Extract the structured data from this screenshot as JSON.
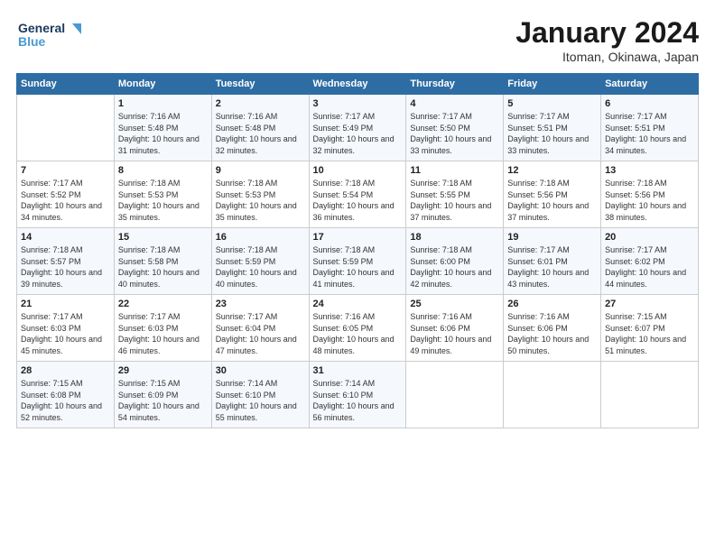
{
  "header": {
    "logo_line1": "General",
    "logo_line2": "Blue",
    "month": "January 2024",
    "location": "Itoman, Okinawa, Japan"
  },
  "weekdays": [
    "Sunday",
    "Monday",
    "Tuesday",
    "Wednesday",
    "Thursday",
    "Friday",
    "Saturday"
  ],
  "weeks": [
    [
      {
        "day": "",
        "sunrise": "",
        "sunset": "",
        "daylight": ""
      },
      {
        "day": "1",
        "sunrise": "7:16 AM",
        "sunset": "5:48 PM",
        "daylight": "10 hours and 31 minutes."
      },
      {
        "day": "2",
        "sunrise": "7:16 AM",
        "sunset": "5:48 PM",
        "daylight": "10 hours and 32 minutes."
      },
      {
        "day": "3",
        "sunrise": "7:17 AM",
        "sunset": "5:49 PM",
        "daylight": "10 hours and 32 minutes."
      },
      {
        "day": "4",
        "sunrise": "7:17 AM",
        "sunset": "5:50 PM",
        "daylight": "10 hours and 33 minutes."
      },
      {
        "day": "5",
        "sunrise": "7:17 AM",
        "sunset": "5:51 PM",
        "daylight": "10 hours and 33 minutes."
      },
      {
        "day": "6",
        "sunrise": "7:17 AM",
        "sunset": "5:51 PM",
        "daylight": "10 hours and 34 minutes."
      }
    ],
    [
      {
        "day": "7",
        "sunrise": "7:17 AM",
        "sunset": "5:52 PM",
        "daylight": "10 hours and 34 minutes."
      },
      {
        "day": "8",
        "sunrise": "7:18 AM",
        "sunset": "5:53 PM",
        "daylight": "10 hours and 35 minutes."
      },
      {
        "day": "9",
        "sunrise": "7:18 AM",
        "sunset": "5:53 PM",
        "daylight": "10 hours and 35 minutes."
      },
      {
        "day": "10",
        "sunrise": "7:18 AM",
        "sunset": "5:54 PM",
        "daylight": "10 hours and 36 minutes."
      },
      {
        "day": "11",
        "sunrise": "7:18 AM",
        "sunset": "5:55 PM",
        "daylight": "10 hours and 37 minutes."
      },
      {
        "day": "12",
        "sunrise": "7:18 AM",
        "sunset": "5:56 PM",
        "daylight": "10 hours and 37 minutes."
      },
      {
        "day": "13",
        "sunrise": "7:18 AM",
        "sunset": "5:56 PM",
        "daylight": "10 hours and 38 minutes."
      }
    ],
    [
      {
        "day": "14",
        "sunrise": "7:18 AM",
        "sunset": "5:57 PM",
        "daylight": "10 hours and 39 minutes."
      },
      {
        "day": "15",
        "sunrise": "7:18 AM",
        "sunset": "5:58 PM",
        "daylight": "10 hours and 40 minutes."
      },
      {
        "day": "16",
        "sunrise": "7:18 AM",
        "sunset": "5:59 PM",
        "daylight": "10 hours and 40 minutes."
      },
      {
        "day": "17",
        "sunrise": "7:18 AM",
        "sunset": "5:59 PM",
        "daylight": "10 hours and 41 minutes."
      },
      {
        "day": "18",
        "sunrise": "7:18 AM",
        "sunset": "6:00 PM",
        "daylight": "10 hours and 42 minutes."
      },
      {
        "day": "19",
        "sunrise": "7:17 AM",
        "sunset": "6:01 PM",
        "daylight": "10 hours and 43 minutes."
      },
      {
        "day": "20",
        "sunrise": "7:17 AM",
        "sunset": "6:02 PM",
        "daylight": "10 hours and 44 minutes."
      }
    ],
    [
      {
        "day": "21",
        "sunrise": "7:17 AM",
        "sunset": "6:03 PM",
        "daylight": "10 hours and 45 minutes."
      },
      {
        "day": "22",
        "sunrise": "7:17 AM",
        "sunset": "6:03 PM",
        "daylight": "10 hours and 46 minutes."
      },
      {
        "day": "23",
        "sunrise": "7:17 AM",
        "sunset": "6:04 PM",
        "daylight": "10 hours and 47 minutes."
      },
      {
        "day": "24",
        "sunrise": "7:16 AM",
        "sunset": "6:05 PM",
        "daylight": "10 hours and 48 minutes."
      },
      {
        "day": "25",
        "sunrise": "7:16 AM",
        "sunset": "6:06 PM",
        "daylight": "10 hours and 49 minutes."
      },
      {
        "day": "26",
        "sunrise": "7:16 AM",
        "sunset": "6:06 PM",
        "daylight": "10 hours and 50 minutes."
      },
      {
        "day": "27",
        "sunrise": "7:15 AM",
        "sunset": "6:07 PM",
        "daylight": "10 hours and 51 minutes."
      }
    ],
    [
      {
        "day": "28",
        "sunrise": "7:15 AM",
        "sunset": "6:08 PM",
        "daylight": "10 hours and 52 minutes."
      },
      {
        "day": "29",
        "sunrise": "7:15 AM",
        "sunset": "6:09 PM",
        "daylight": "10 hours and 54 minutes."
      },
      {
        "day": "30",
        "sunrise": "7:14 AM",
        "sunset": "6:10 PM",
        "daylight": "10 hours and 55 minutes."
      },
      {
        "day": "31",
        "sunrise": "7:14 AM",
        "sunset": "6:10 PM",
        "daylight": "10 hours and 56 minutes."
      },
      {
        "day": "",
        "sunrise": "",
        "sunset": "",
        "daylight": ""
      },
      {
        "day": "",
        "sunrise": "",
        "sunset": "",
        "daylight": ""
      },
      {
        "day": "",
        "sunrise": "",
        "sunset": "",
        "daylight": ""
      }
    ]
  ],
  "labels": {
    "sunrise_prefix": "Sunrise: ",
    "sunset_prefix": "Sunset: ",
    "daylight_prefix": "Daylight: "
  }
}
